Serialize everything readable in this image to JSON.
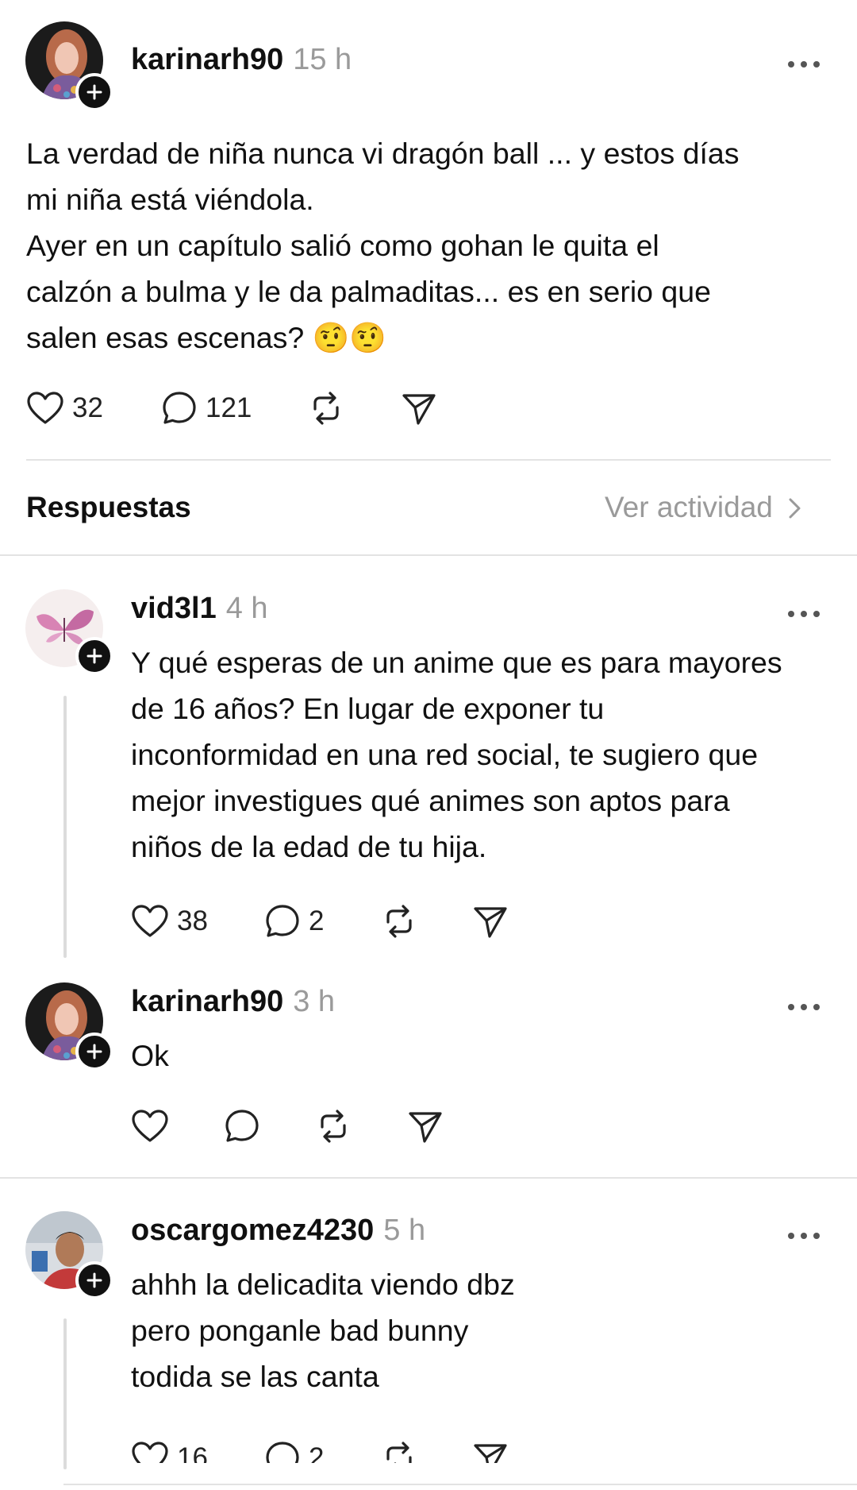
{
  "main_post": {
    "username": "karinarh90",
    "time": "15 h",
    "more_icon": "more-horizontal-icon",
    "lines": [
      "La verdad de niña nunca vi dragón ball ... y estos días",
      "mi niña está viéndola.",
      "Ayer en un capítulo salió como gohan le quita el",
      "calzón a bulma y le da palmaditas... es en serio que",
      "salen esas escenas? 🤨🤨"
    ],
    "likes": "32",
    "comments": "121"
  },
  "replies_header": {
    "title": "Respuestas",
    "activity_label": "Ver actividad",
    "chevron": "›"
  },
  "replies": [
    {
      "username": "vid3l1",
      "time": "4 h",
      "lines": [
        "Y qué esperas de un anime que es para mayores",
        "de 16 años? En lugar de exponer tu",
        "inconformidad en una red social, te sugiero que",
        "mejor investigues qué animes son aptos para",
        "niños de la edad de tu hija."
      ],
      "likes": "38",
      "comments": "2"
    },
    {
      "username": "karinarh90",
      "time": "3 h",
      "lines": [
        "Ok"
      ],
      "likes": "",
      "comments": ""
    },
    {
      "username": "oscargomez4230",
      "time": "5 h",
      "lines": [
        "ahhh la delicadita  viendo dbz",
        "pero ponganle bad bunny",
        "todida se las canta"
      ],
      "likes": "16",
      "comments": "2"
    }
  ],
  "icons": {
    "like": "heart-icon",
    "comment": "comment-bubble-icon",
    "repost": "repost-icon",
    "share": "send-icon",
    "follow": "plus-icon"
  },
  "colors": {
    "text": "#101010",
    "muted": "#9a9a9a",
    "divider": "#e3e3e3"
  }
}
